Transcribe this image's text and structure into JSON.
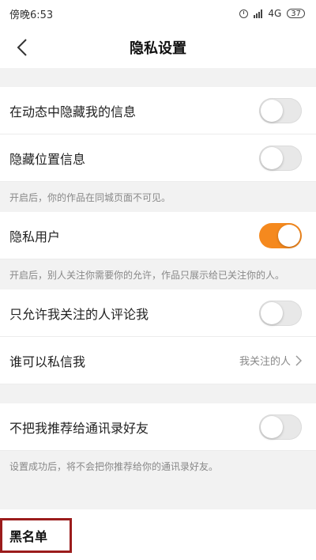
{
  "status_bar": {
    "time": "傍晚6:53",
    "network": "4G",
    "battery": "37"
  },
  "nav": {
    "title": "隐私设置"
  },
  "settings": {
    "hide_in_feed": {
      "label": "在动态中隐藏我的信息",
      "enabled": false
    },
    "hide_location": {
      "label": "隐藏位置信息",
      "enabled": false,
      "hint": "开启后，你的作品在同城页面不可见。"
    },
    "private_user": {
      "label": "隐私用户",
      "enabled": true,
      "hint": "开启后，别人关注你需要你的允许，作品只展示给已关注你的人。"
    },
    "comment_only_followed": {
      "label": "只允许我关注的人评论我",
      "enabled": false
    },
    "who_can_message": {
      "label": "谁可以私信我",
      "value": "我关注的人"
    },
    "no_recommend_contacts": {
      "label": "不把我推荐给通讯录好友",
      "enabled": false,
      "hint": "设置成功后，将不会把你推荐给你的通讯录好友。"
    },
    "blacklist": {
      "label": "黑名单"
    }
  },
  "colors": {
    "toggle_on": "#f5891e",
    "highlight_border": "#9b1c1c"
  }
}
